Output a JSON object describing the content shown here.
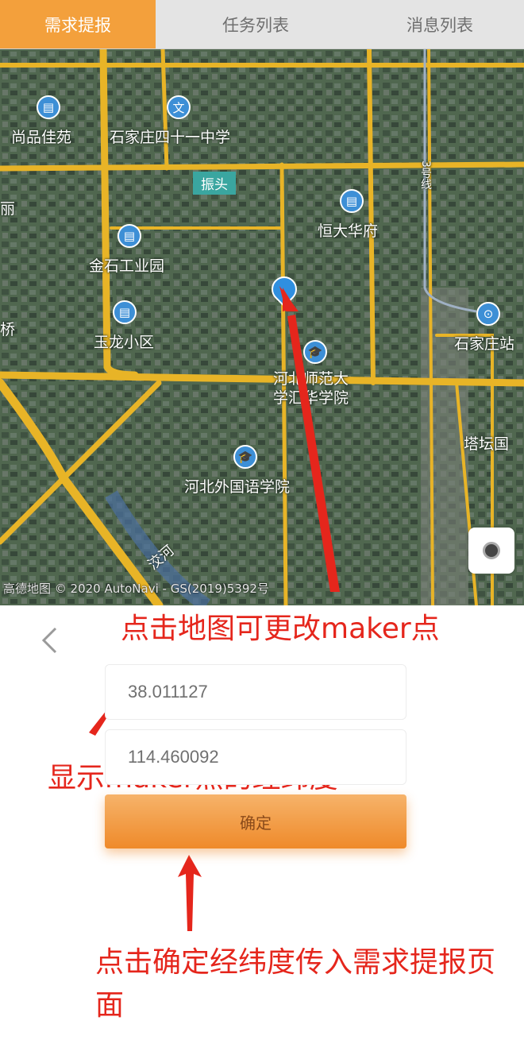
{
  "tabs": [
    {
      "label": "需求提报",
      "active": true
    },
    {
      "label": "任务列表",
      "active": false
    },
    {
      "label": "消息列表",
      "active": false
    }
  ],
  "map": {
    "pois": {
      "shangpin": "尚品佳苑",
      "school41": "石家庄四十一中学",
      "zhentou": "振头",
      "hengda": "恒大华府",
      "jinshi": "金石工业园",
      "yulong": "玉龙小区",
      "normal_line1": "河北师范大",
      "normal_line2": "学汇华学院",
      "waiyu": "河北外国语学院",
      "sjz_station": "石家庄站",
      "tacheng": "塔坛国",
      "partial_left1": "丽",
      "partial_left2": "桥",
      "line3": "3号线",
      "river": "洨河"
    },
    "copyright": "高德地图 © 2020 AutoNavi - GS(2019)5392号",
    "icon_colors": {
      "poi": "#3d8fd6",
      "marker": "#2f8fe0",
      "road": "#e8b427"
    }
  },
  "annotations": {
    "map_tip": "点击地图可更改maker点",
    "coord_tip": "显示maker点的经纬度",
    "confirm_tip": "点击确定经纬度传入需求提报页面"
  },
  "form": {
    "latitude": "38.011127",
    "longitude": "114.460092",
    "confirm_label": "确定"
  },
  "colors": {
    "tab_active": "#f3a03c",
    "annotation": "#e5261c",
    "button": "#ef8a2a"
  }
}
